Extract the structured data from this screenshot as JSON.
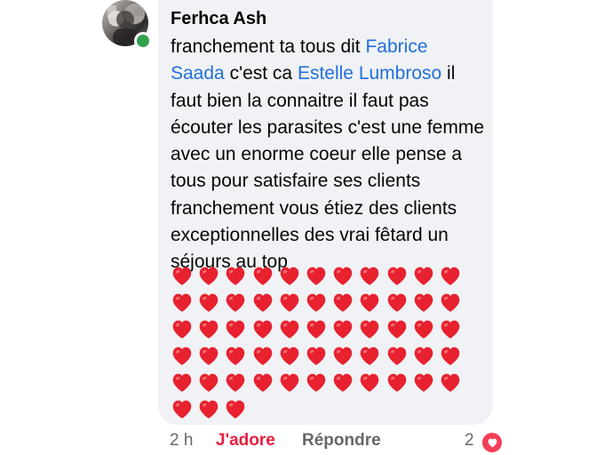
{
  "comment": {
    "author": "Ferhca Ash",
    "text_parts": [
      "franchement ta tous dit ",
      "Fabrice Saada",
      " c'est ca ",
      "Estelle Lumbroso",
      " il faut bien la connaitre il faut pas écouter les parasites c'est une femme avec un enorme coeur elle pense a tous pour satisfaire ses clients franchement vous étiez des clients exceptionnelles des vrai fêtard un séjours au top"
    ],
    "mentions": [
      "Fabrice Saada",
      "Estelle Lumbroso"
    ],
    "heart_emoji": "❤️",
    "heart_count": 58,
    "online": true
  },
  "meta": {
    "time": "2 h",
    "reaction_label": "J'adore",
    "reply_label": "Répondre",
    "reaction_count": "2"
  },
  "colors": {
    "bubble_bg": "#f0f2f5",
    "mention": "#216fdb",
    "love": "#e41e3f",
    "muted": "#65676b",
    "online": "#31a24c",
    "heart": "#e8212f"
  },
  "icons": {
    "avatar": "profile-photo",
    "reaction": "heart-reaction-icon"
  }
}
